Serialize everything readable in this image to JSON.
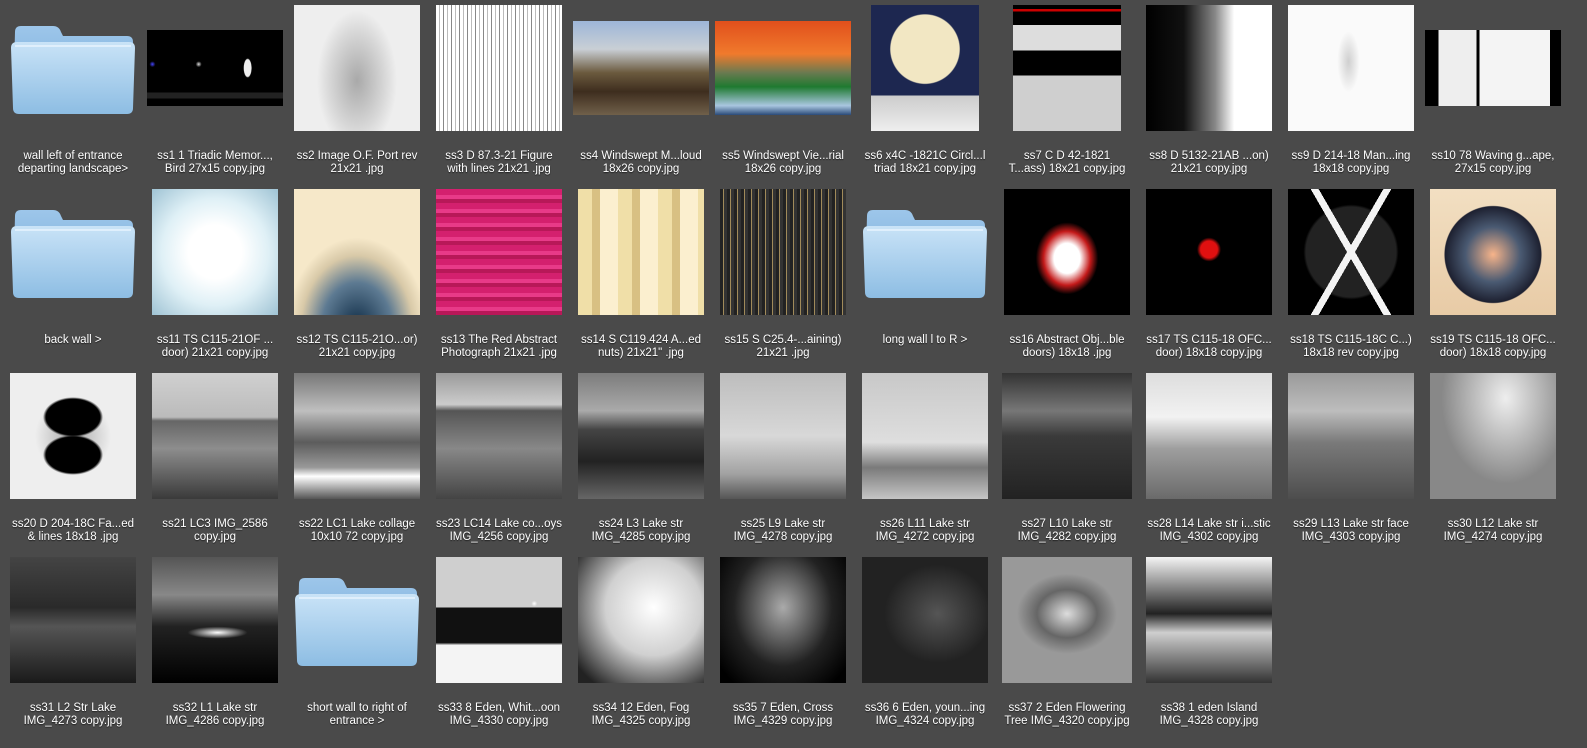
{
  "items": [
    {
      "kind": "folder",
      "caption": "wall left of entrance\ndeparting landscape>"
    },
    {
      "kind": "image",
      "style": "triadic",
      "caption": "ss1  1 Triadic Memor...,\nBird  27x15  copy.jpg"
    },
    {
      "kind": "image",
      "style": "ghost",
      "caption": "ss2 Image   O.F. Port rev\n21x21  .jpg"
    },
    {
      "kind": "image",
      "style": "lines",
      "caption": "ss3 D 87.3-21 Figure\nwith lines 21x21  .jpg"
    },
    {
      "kind": "image",
      "style": "windswept_m",
      "caption": "ss4  Windswept M...loud\n18x26 copy.jpg"
    },
    {
      "kind": "image",
      "style": "windswept_v",
      "caption": "ss5 Windswept Vie...rial\n18x26   copy.jpg"
    },
    {
      "kind": "image",
      "style": "circle_triad",
      "caption": "ss6 x4C -1821C Circl...l\ntriad 18x21  copy.jpg"
    },
    {
      "kind": "image",
      "style": "cd",
      "caption": "ss7 C D 42-1821\nT...ass) 18x21  copy.jpg"
    },
    {
      "kind": "image",
      "style": "gradient_bw",
      "caption": "ss8 D 5132-21AB  ...on)\n21x21  copy.jpg"
    },
    {
      "kind": "image",
      "style": "man",
      "caption": "ss9 D 214-18 Man...ing\n18x18  copy.jpg"
    },
    {
      "kind": "image",
      "style": "waving",
      "caption": "ss10 78  Waving g...ape,\n27x15  copy.jpg"
    },
    {
      "kind": "folder",
      "caption": "back wall >"
    },
    {
      "kind": "image",
      "style": "ts_white",
      "caption": "ss11 TS  C115-21OF ...\ndoor) 21x21  copy.jpg"
    },
    {
      "kind": "image",
      "style": "ts_peak",
      "caption": "ss12 TS C115-21O...or)\n21x21  copy.jpg"
    },
    {
      "kind": "image",
      "style": "red_abstract",
      "caption": "ss13 The Red Abstract\nPhotograph  21x21  .jpg"
    },
    {
      "kind": "image",
      "style": "cream_stripes",
      "caption": "ss14 S C119.424  A...ed\nnuts)  21x21\"  .jpg"
    },
    {
      "kind": "image",
      "style": "pattern",
      "caption": "ss15  S C25.4-...aining)\n21x21 .jpg"
    },
    {
      "kind": "folder",
      "caption": "long wall l to R >"
    },
    {
      "kind": "image",
      "style": "glow_white",
      "caption": "ss16  Abstract Obj...ble\ndoors) 18x18  .jpg"
    },
    {
      "kind": "image",
      "style": "red_spot",
      "caption": "ss17 TS C115-18 OFC...\ndoor) 18x18  copy.jpg"
    },
    {
      "kind": "image",
      "style": "triangle",
      "caption": "ss18 TS C115-18C C...)\n18x18 rev  copy.jpg"
    },
    {
      "kind": "image",
      "style": "orb",
      "caption": "ss19 TS C115-18 OFC...\ndoor) 18x18  copy.jpg"
    },
    {
      "kind": "image",
      "style": "circles_bw",
      "caption": "ss20 D 204-18C Fa...ed\n& lines 18x18 .jpg"
    },
    {
      "kind": "image",
      "style": "lake_rock",
      "caption": "ss21 LC3 IMG_2586\ncopy.jpg"
    },
    {
      "kind": "image",
      "style": "lake_clouds",
      "caption": "ss22 LC1 Lake collage\n10x10  72  copy.jpg"
    },
    {
      "kind": "image",
      "style": "lake_horizon",
      "caption": "ss23 LC14 Lake co...oys\nIMG_4256 copy.jpg"
    },
    {
      "kind": "image",
      "style": "lake_dark",
      "caption": "ss24  L3 Lake str\nIMG_4285 copy.jpg"
    },
    {
      "kind": "image",
      "style": "lake_fog",
      "caption": "ss25 L9 Lake str\nIMG_4278 copy.jpg"
    },
    {
      "kind": "image",
      "style": "lake_wave",
      "caption": "ss26 L11 Lake str\nIMG_4272 copy.jpg"
    },
    {
      "kind": "image",
      "style": "lake_storm",
      "caption": "ss27 L10 Lake str\nIMG_4282 copy.jpg"
    },
    {
      "kind": "image",
      "style": "lake_mist",
      "caption": "ss28 L14 Lake str i...stic\nIMG_4302 copy.jpg"
    },
    {
      "kind": "image",
      "style": "lake_face",
      "caption": "ss29 L13 Lake str face\nIMG_4303 copy.jpg"
    },
    {
      "kind": "image",
      "style": "lake_sky",
      "caption": "ss30 L12  Lake str\nIMG_4274 copy.jpg"
    },
    {
      "kind": "image",
      "style": "lake_night",
      "caption": "ss31 L2 Str Lake\nIMG_4273 copy.jpg"
    },
    {
      "kind": "image",
      "style": "lake_glow",
      "caption": "ss32 L1 Lake str\nIMG_4286 copy.jpg"
    },
    {
      "kind": "folder",
      "caption": "short  wall to right of\nentrance >"
    },
    {
      "kind": "image",
      "style": "eden_snow",
      "caption": "ss33 8 Eden, Whit...oon\nIMG_4330 copy.jpg"
    },
    {
      "kind": "image",
      "style": "eden_fog",
      "caption": "ss34 12 Eden, Fog\nIMG_4325 copy.jpg"
    },
    {
      "kind": "image",
      "style": "eden_cross",
      "caption": "ss35 7 Eden, Cross\nIMG_4329 copy.jpg"
    },
    {
      "kind": "image",
      "style": "eden_young",
      "caption": "ss36 6 Eden, youn...ing\nIMG_4324 copy.jpg"
    },
    {
      "kind": "image",
      "style": "eden_tree",
      "caption": "ss37 2 Eden Flowering\nTree IMG_4320 copy.jpg"
    },
    {
      "kind": "image",
      "style": "eden_island",
      "caption": "ss38 1 eden Island\nIMG_4328 copy.jpg"
    }
  ]
}
